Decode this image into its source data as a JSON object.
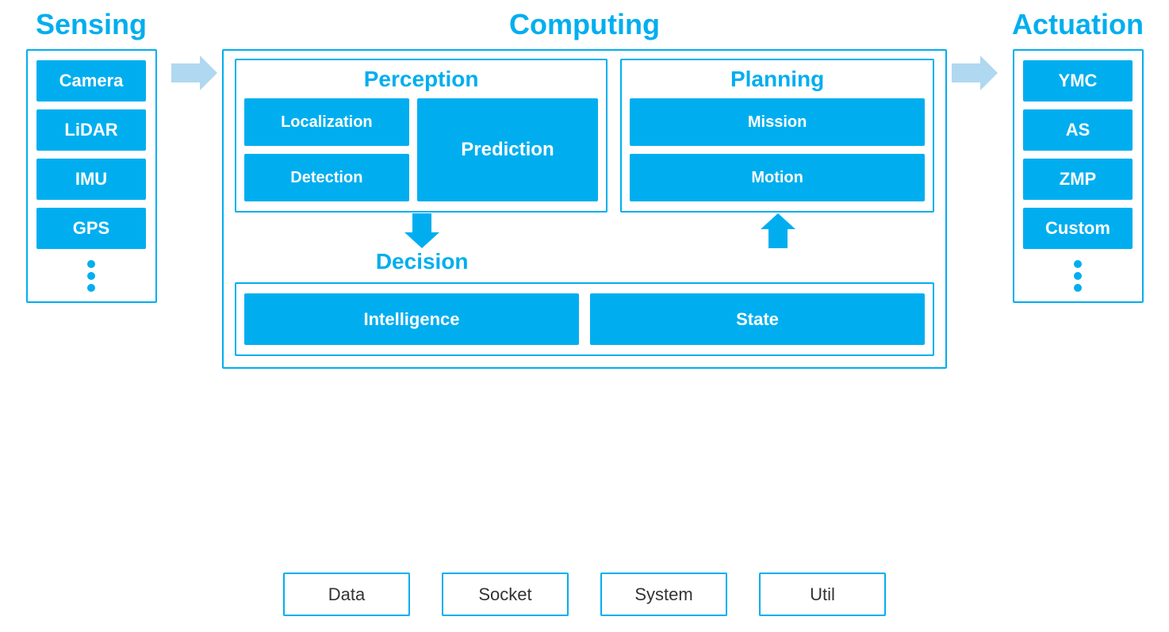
{
  "sensing": {
    "title": "Sensing",
    "items": [
      "Camera",
      "LiDAR",
      "IMU",
      "GPS"
    ]
  },
  "computing": {
    "title": "Computing",
    "perception": {
      "title": "Perception",
      "localization": "Localization",
      "detection": "Detection",
      "prediction": "Prediction"
    },
    "planning": {
      "title": "Planning",
      "mission": "Mission",
      "motion": "Motion"
    },
    "decision": {
      "title": "Decision",
      "intelligence": "Intelligence",
      "state": "State"
    }
  },
  "actuation": {
    "title": "Actuation",
    "items": [
      "YMC",
      "AS",
      "ZMP",
      "Custom"
    ]
  },
  "bottom": {
    "items": [
      "Data",
      "Socket",
      "System",
      "Util"
    ]
  }
}
